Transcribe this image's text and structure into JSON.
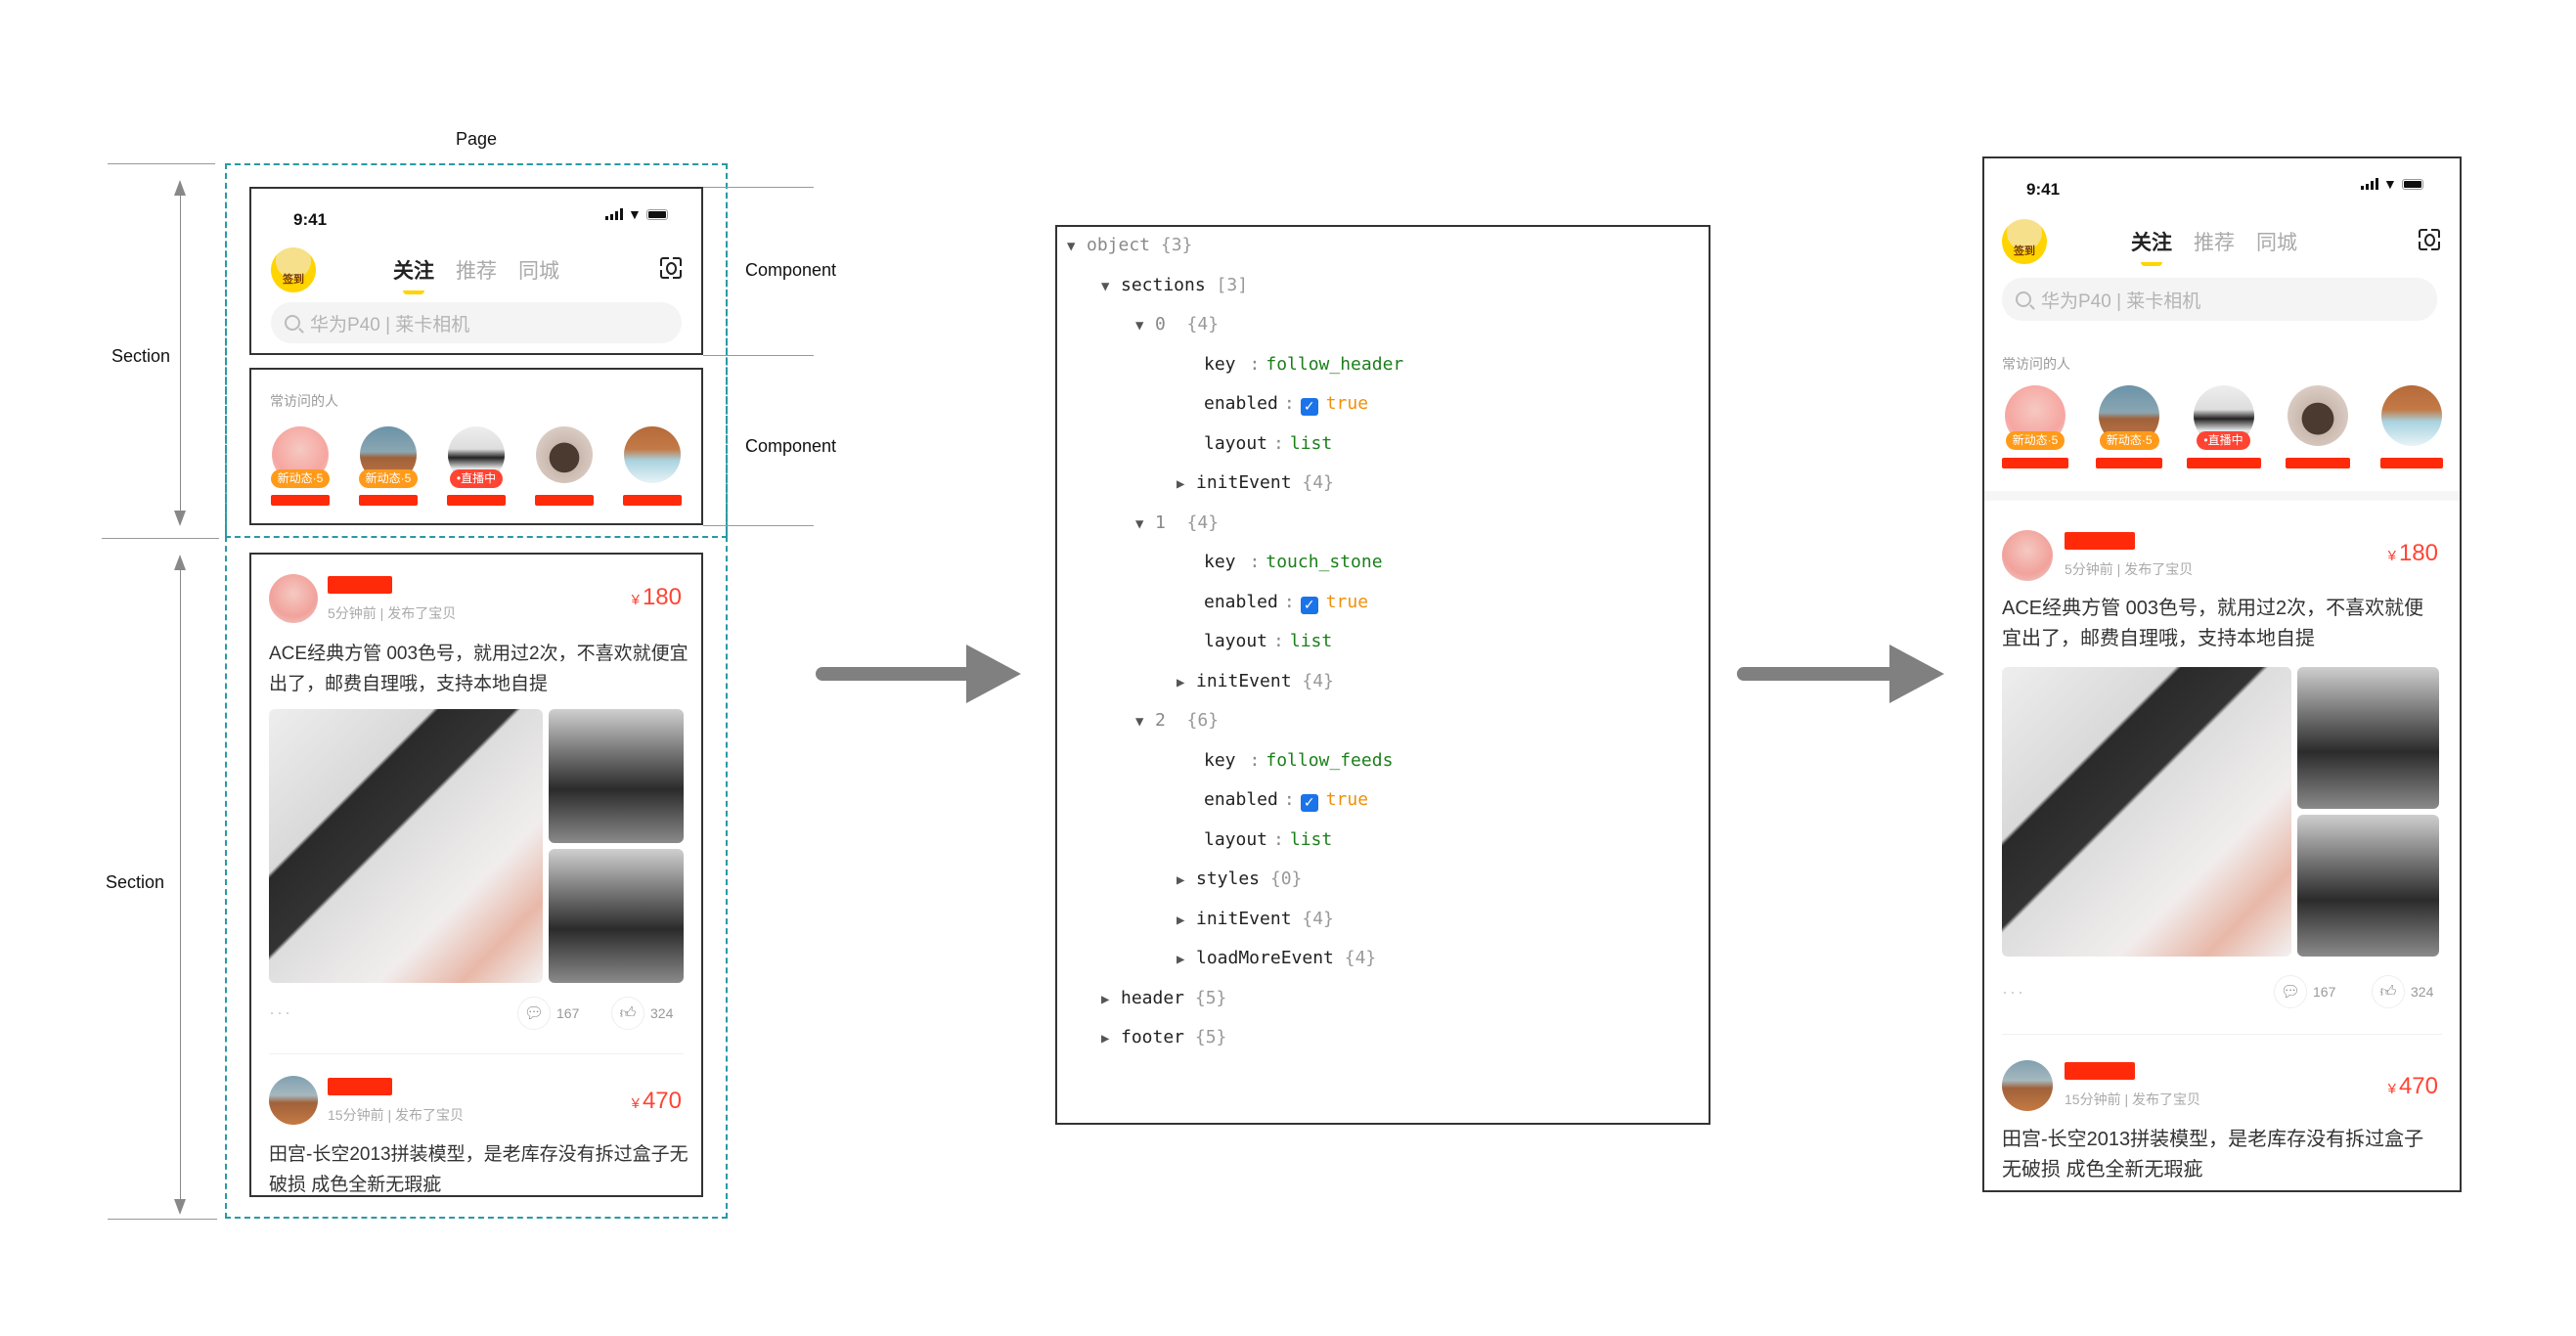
{
  "diagram": {
    "page_label": "Page",
    "section_labels": [
      "Section",
      "Section"
    ],
    "component_labels": [
      "Component",
      "Component"
    ],
    "colors": {
      "dashed_outline": "#2a9aa3",
      "arrow": "#808080",
      "accent_yellow": "#ffd400",
      "price_red": "#ff4433",
      "badge_orange": "#ff9a1a",
      "json_string": "#1b7f1b",
      "json_bool": "#f0900a",
      "checkbox": "#1a73e8"
    }
  },
  "phone": {
    "status_time": "9:41",
    "signin_label": "签到",
    "tabs": [
      {
        "label": "关注",
        "active": true
      },
      {
        "label": "推荐",
        "active": false
      },
      {
        "label": "同城",
        "active": false
      }
    ],
    "scan_icon": "scan-icon",
    "search_placeholder": "华为P40 | 莱卡相机",
    "visited_title": "常访问的人",
    "visitors": [
      {
        "badge": "新动态·5",
        "badge_type": "orange"
      },
      {
        "badge": "新动态·5",
        "badge_type": "orange"
      },
      {
        "badge": "•直播中",
        "badge_type": "red"
      },
      {
        "badge": "",
        "badge_type": ""
      },
      {
        "badge": "",
        "badge_type": ""
      }
    ],
    "posts": [
      {
        "meta": "5分钟前 | 发布了宝贝",
        "currency": "¥",
        "price": "180",
        "text": "ACE经典方管 003色号，就用过2次，不喜欢就便宜出了，邮费自理哦，支持本地自提",
        "more": "···",
        "comments": "167",
        "likes": "324"
      },
      {
        "meta": "15分钟前 | 发布了宝贝",
        "currency": "¥",
        "price": "470",
        "text": "田宫-长空2013拼装模型，是老库存没有拆过盒子无破损 成色全新无瑕疵"
      }
    ]
  },
  "json_tree": {
    "rows": [
      {
        "indent": 0,
        "toggle": "▼",
        "key": "object",
        "count": "{3}",
        "key_muted": true
      },
      {
        "indent": 1,
        "toggle": "▼",
        "key": "sections",
        "count": "[3]"
      },
      {
        "indent": 2,
        "toggle": "▼",
        "key": "0",
        "count": "{4}",
        "is_index": true
      },
      {
        "indent": 3,
        "key": "key",
        "colon": ":",
        "value": "follow_header",
        "vtype": "string"
      },
      {
        "indent": 3,
        "key": "enabled",
        "colon": ":",
        "value": "true",
        "vtype": "bool"
      },
      {
        "indent": 3,
        "key": "layout",
        "colon": ":",
        "value": "list",
        "vtype": "string"
      },
      {
        "indent": 3,
        "toggle": "▶",
        "key": "initEvent",
        "count": "{4}"
      },
      {
        "indent": 2,
        "toggle": "▼",
        "key": "1",
        "count": "{4}",
        "is_index": true
      },
      {
        "indent": 3,
        "key": "key",
        "colon": ":",
        "value": "touch_stone",
        "vtype": "string"
      },
      {
        "indent": 3,
        "key": "enabled",
        "colon": ":",
        "value": "true",
        "vtype": "bool"
      },
      {
        "indent": 3,
        "key": "layout",
        "colon": ":",
        "value": "list",
        "vtype": "string"
      },
      {
        "indent": 3,
        "toggle": "▶",
        "key": "initEvent",
        "count": "{4}"
      },
      {
        "indent": 2,
        "toggle": "▼",
        "key": "2",
        "count": "{6}",
        "is_index": true
      },
      {
        "indent": 3,
        "key": "key",
        "colon": ":",
        "value": "follow_feeds",
        "vtype": "string"
      },
      {
        "indent": 3,
        "key": "enabled",
        "colon": ":",
        "value": "true",
        "vtype": "bool"
      },
      {
        "indent": 3,
        "key": "layout",
        "colon": ":",
        "value": "list",
        "vtype": "string"
      },
      {
        "indent": 3,
        "toggle": "▶",
        "key": "styles",
        "count": "{0}"
      },
      {
        "indent": 3,
        "toggle": "▶",
        "key": "initEvent",
        "count": "{4}"
      },
      {
        "indent": 3,
        "toggle": "▶",
        "key": "loadMoreEvent",
        "count": "{4}"
      },
      {
        "indent": 1,
        "toggle": "▶",
        "key": "header",
        "count": "{5}"
      },
      {
        "indent": 1,
        "toggle": "▶",
        "key": "footer",
        "count": "{5}"
      }
    ]
  }
}
